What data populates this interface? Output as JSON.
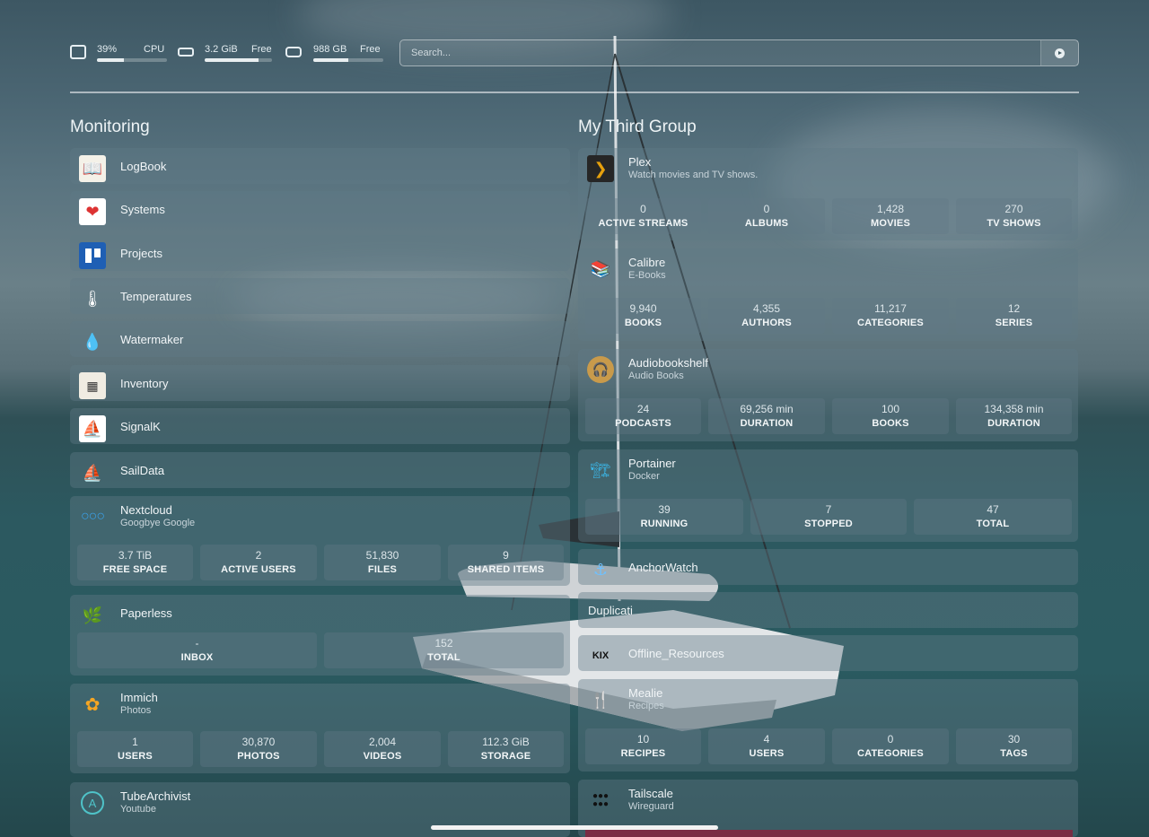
{
  "topbar": {
    "cpu": {
      "value": "39%",
      "label": "CPU",
      "fraction": 0.39,
      "icon": "cpu-icon"
    },
    "memory": {
      "value": "3.2 GiB",
      "label": "Free",
      "fraction": 0.8,
      "icon": "memory-icon"
    },
    "disk": {
      "value": "988 GB",
      "label": "Free",
      "fraction": 0.5,
      "icon": "disk-icon"
    },
    "search": {
      "placeholder": "Search...",
      "icon": "go-arrow-icon"
    }
  },
  "groups": {
    "monitoring": {
      "title": "Monitoring",
      "items": [
        {
          "name": "LogBook",
          "icon": "book-icon"
        },
        {
          "name": "Systems",
          "icon": "heart-pulse-icon"
        },
        {
          "name": "Projects",
          "icon": "trello-icon"
        },
        {
          "name": "Temperatures",
          "icon": "thermometer-icon"
        },
        {
          "name": "Watermaker",
          "icon": "water-drop-icon"
        },
        {
          "name": "Inventory",
          "icon": "inventory-icon"
        },
        {
          "name": "SignalK",
          "icon": "signalk-icon"
        },
        {
          "name": "SailData",
          "icon": "sailboat-icon"
        },
        {
          "name": "Nextcloud",
          "sub": "Googbye Google",
          "icon": "nextcloud-icon",
          "blocks": [
            {
              "v": "3.7 TiB",
              "l": "FREE SPACE"
            },
            {
              "v": "2",
              "l": "ACTIVE USERS"
            },
            {
              "v": "51,830",
              "l": "FILES"
            },
            {
              "v": "9",
              "l": "SHARED ITEMS"
            }
          ]
        },
        {
          "name": "Paperless",
          "icon": "leaf-icon",
          "blocks": [
            {
              "v": "-",
              "l": "INBOX"
            },
            {
              "v": "152",
              "l": "TOTAL"
            }
          ]
        },
        {
          "name": "Immich",
          "sub": "Photos",
          "icon": "immich-icon",
          "blocks": [
            {
              "v": "1",
              "l": "USERS"
            },
            {
              "v": "30,870",
              "l": "PHOTOS"
            },
            {
              "v": "2,004",
              "l": "VIDEOS"
            },
            {
              "v": "112.3 GiB",
              "l": "STORAGE"
            }
          ]
        },
        {
          "name": "TubeArchivist",
          "sub": "Youtube",
          "icon": "tubearchivist-icon"
        }
      ]
    },
    "third": {
      "title": "My Third Group",
      "items": [
        {
          "name": "Plex",
          "sub": "Watch movies and TV shows.",
          "icon": "plex-icon",
          "blocks": [
            {
              "v": "0",
              "l": "ACTIVE STREAMS"
            },
            {
              "v": "0",
              "l": "ALBUMS"
            },
            {
              "v": "1,428",
              "l": "MOVIES"
            },
            {
              "v": "270",
              "l": "TV SHOWS"
            }
          ]
        },
        {
          "name": "Calibre",
          "sub": "E-Books",
          "icon": "calibre-icon",
          "blocks": [
            {
              "v": "9,940",
              "l": "BOOKS"
            },
            {
              "v": "4,355",
              "l": "AUTHORS"
            },
            {
              "v": "11,217",
              "l": "CATEGORIES"
            },
            {
              "v": "12",
              "l": "SERIES"
            }
          ]
        },
        {
          "name": "Audiobookshelf",
          "sub": "Audio Books",
          "icon": "audiobookshelf-icon",
          "blocks": [
            {
              "v": "24",
              "l": "PODCASTS"
            },
            {
              "v": "69,256 min",
              "l": "DURATION"
            },
            {
              "v": "100",
              "l": "BOOKS"
            },
            {
              "v": "134,358 min",
              "l": "DURATION"
            }
          ]
        },
        {
          "name": "Portainer",
          "sub": "Docker",
          "icon": "portainer-icon",
          "blocks": [
            {
              "v": "39",
              "l": "RUNNING"
            },
            {
              "v": "7",
              "l": "STOPPED"
            },
            {
              "v": "47",
              "l": "TOTAL"
            }
          ]
        },
        {
          "name": "AnchorWatch",
          "icon": "anchor-icon"
        },
        {
          "name": "Duplicati"
        },
        {
          "name": "Offline_Resources",
          "icon": "kiwix-icon"
        },
        {
          "name": "Mealie",
          "sub": "Recipes",
          "icon": "mealie-icon",
          "blocks": [
            {
              "v": "10",
              "l": "RECIPES"
            },
            {
              "v": "4",
              "l": "USERS"
            },
            {
              "v": "0",
              "l": "CATEGORIES"
            },
            {
              "v": "30",
              "l": "TAGS"
            }
          ]
        },
        {
          "name": "Tailscale",
          "sub": "Wireguard",
          "icon": "tailscale-icon"
        }
      ]
    }
  }
}
